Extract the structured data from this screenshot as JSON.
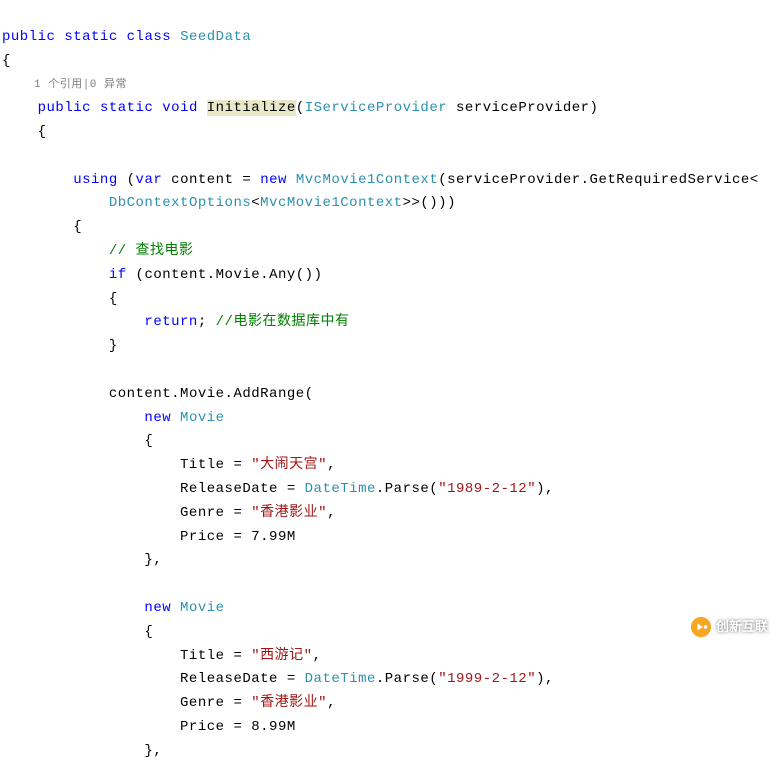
{
  "code": {
    "line1_public": "public",
    "line1_static": "static",
    "line1_class": "class",
    "line1_name": "SeedData",
    "line2_brace": "{",
    "line3_codelens": "1 个引用|0 异常",
    "line4_public": "public",
    "line4_static": "static",
    "line4_void": "void",
    "line4_method": "Initialize",
    "line4_paren_open": "(",
    "line4_iservice": "IServiceProvider",
    "line4_param": " serviceProvider)",
    "line5_brace": "{",
    "line6_using": "using",
    "line6_paren": " (",
    "line6_var": "var",
    "line6_content": " content = ",
    "line6_new": "new",
    "line6_mvc": "MvcMovie1Context",
    "line6_rest": "(serviceProvider.GetRequiredService<",
    "line7_dbc": "DbContextOptions",
    "line7_lt": "<",
    "line7_mvc2": "MvcMovie1Context",
    "line7_rest": ">>()))",
    "line8_brace": "{",
    "line9_comment": "// 查找电影",
    "line10_if": "if",
    "line10_rest": " (content.Movie.Any())",
    "line11_brace": "{",
    "line12_return": "return",
    "line12_semi": "; ",
    "line12_comment": "//电影在数据库中有",
    "line13_brace": "}",
    "line14_content": "content.Movie.AddRange(",
    "line15_new": "new",
    "line15_movie": "Movie",
    "line16_brace": "{",
    "line17_title": "Title = ",
    "line17_str": "\"大闹天宫\"",
    "line17_comma": ",",
    "line18_rd": "ReleaseDate = ",
    "line18_dt": "DateTime",
    "line18_parse": ".Parse(",
    "line18_str": "\"1989-2-12\"",
    "line18_end": "),",
    "line19_genre": "Genre = ",
    "line19_str": "\"香港影业\"",
    "line19_comma": ",",
    "line20_price": "Price = 7.99M",
    "line21_brace": "},",
    "line22_new": "new",
    "line22_movie": "Movie",
    "line23_brace": "{",
    "line24_title": "Title = ",
    "line24_str": "\"西游记\"",
    "line24_comma": ",",
    "line25_rd": "ReleaseDate = ",
    "line25_dt": "DateTime",
    "line25_parse": ".Parse(",
    "line25_str": "\"1999-2-12\"",
    "line25_end": "),",
    "line26_genre": "Genre = ",
    "line26_str": "\"香港影业\"",
    "line26_comma": ",",
    "line27_price": "Price = 8.99M",
    "line28_brace": "},"
  },
  "watermark": {
    "text": "创新互联"
  }
}
